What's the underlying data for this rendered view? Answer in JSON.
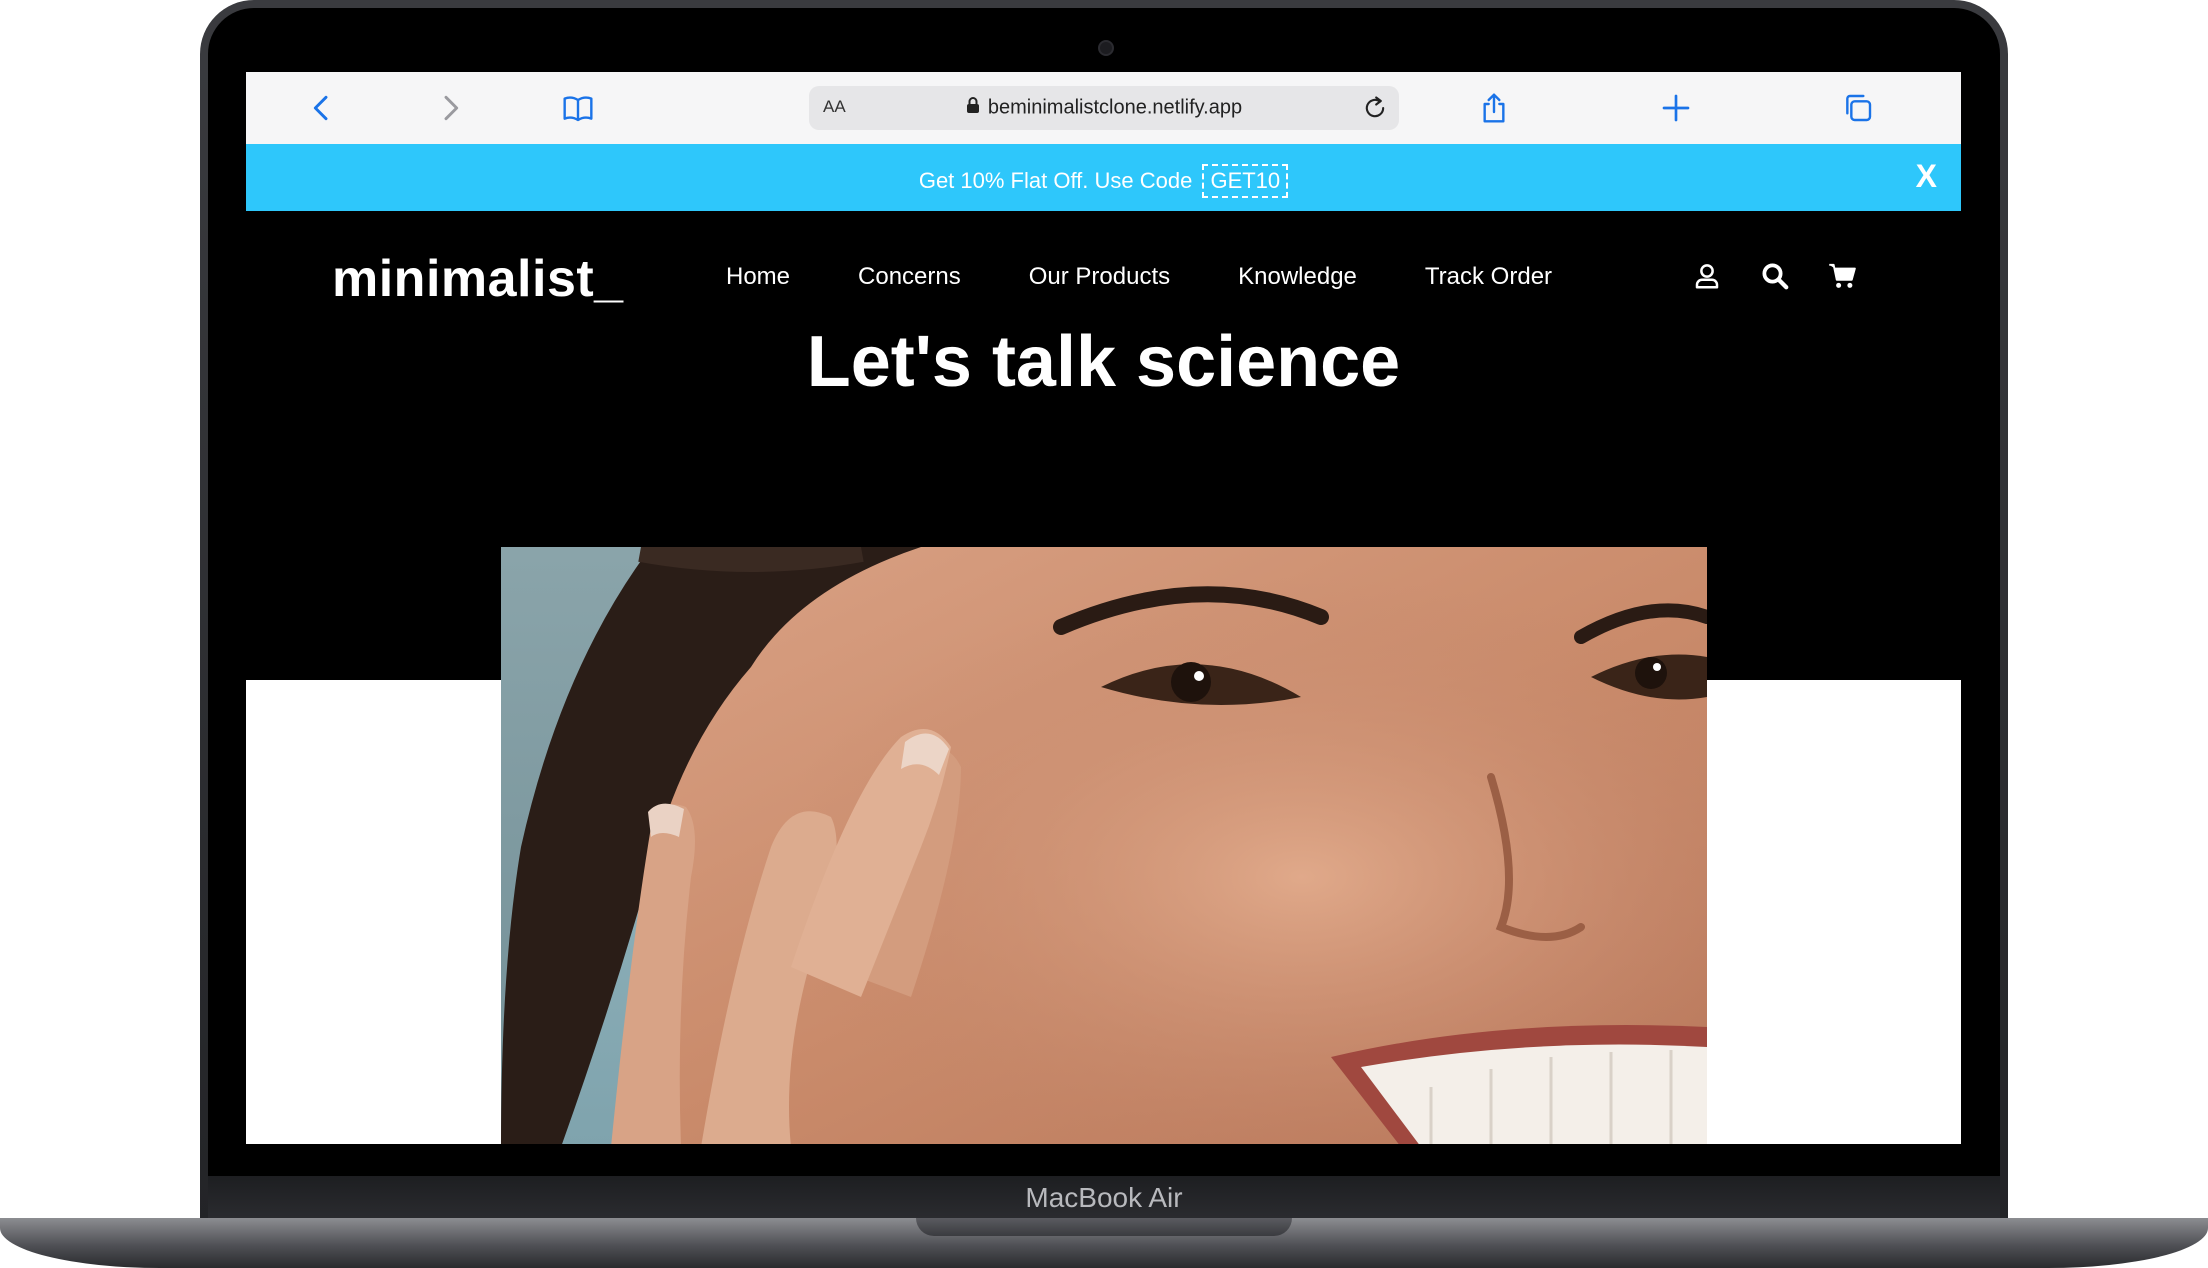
{
  "device": {
    "label": "MacBook Air"
  },
  "browser": {
    "url": "beminimalistclone.netlify.app",
    "text_size_label": "AA",
    "icons": [
      "back-icon",
      "forward-icon",
      "bookmarks-icon",
      "lock-icon",
      "reload-icon",
      "share-icon",
      "new-tab-icon",
      "tabs-icon"
    ]
  },
  "promo": {
    "text": "Get 10% Flat Off. Use Code",
    "code": "GET10",
    "close_label": "X",
    "color": "#2ec7fb"
  },
  "site": {
    "logo": "minimalist_",
    "nav": [
      "Home",
      "Concerns",
      "Our Products",
      "Knowledge",
      "Track Order"
    ],
    "header_icons": [
      "user-icon",
      "search-icon",
      "cart-icon"
    ],
    "headline": "Let's talk science"
  }
}
